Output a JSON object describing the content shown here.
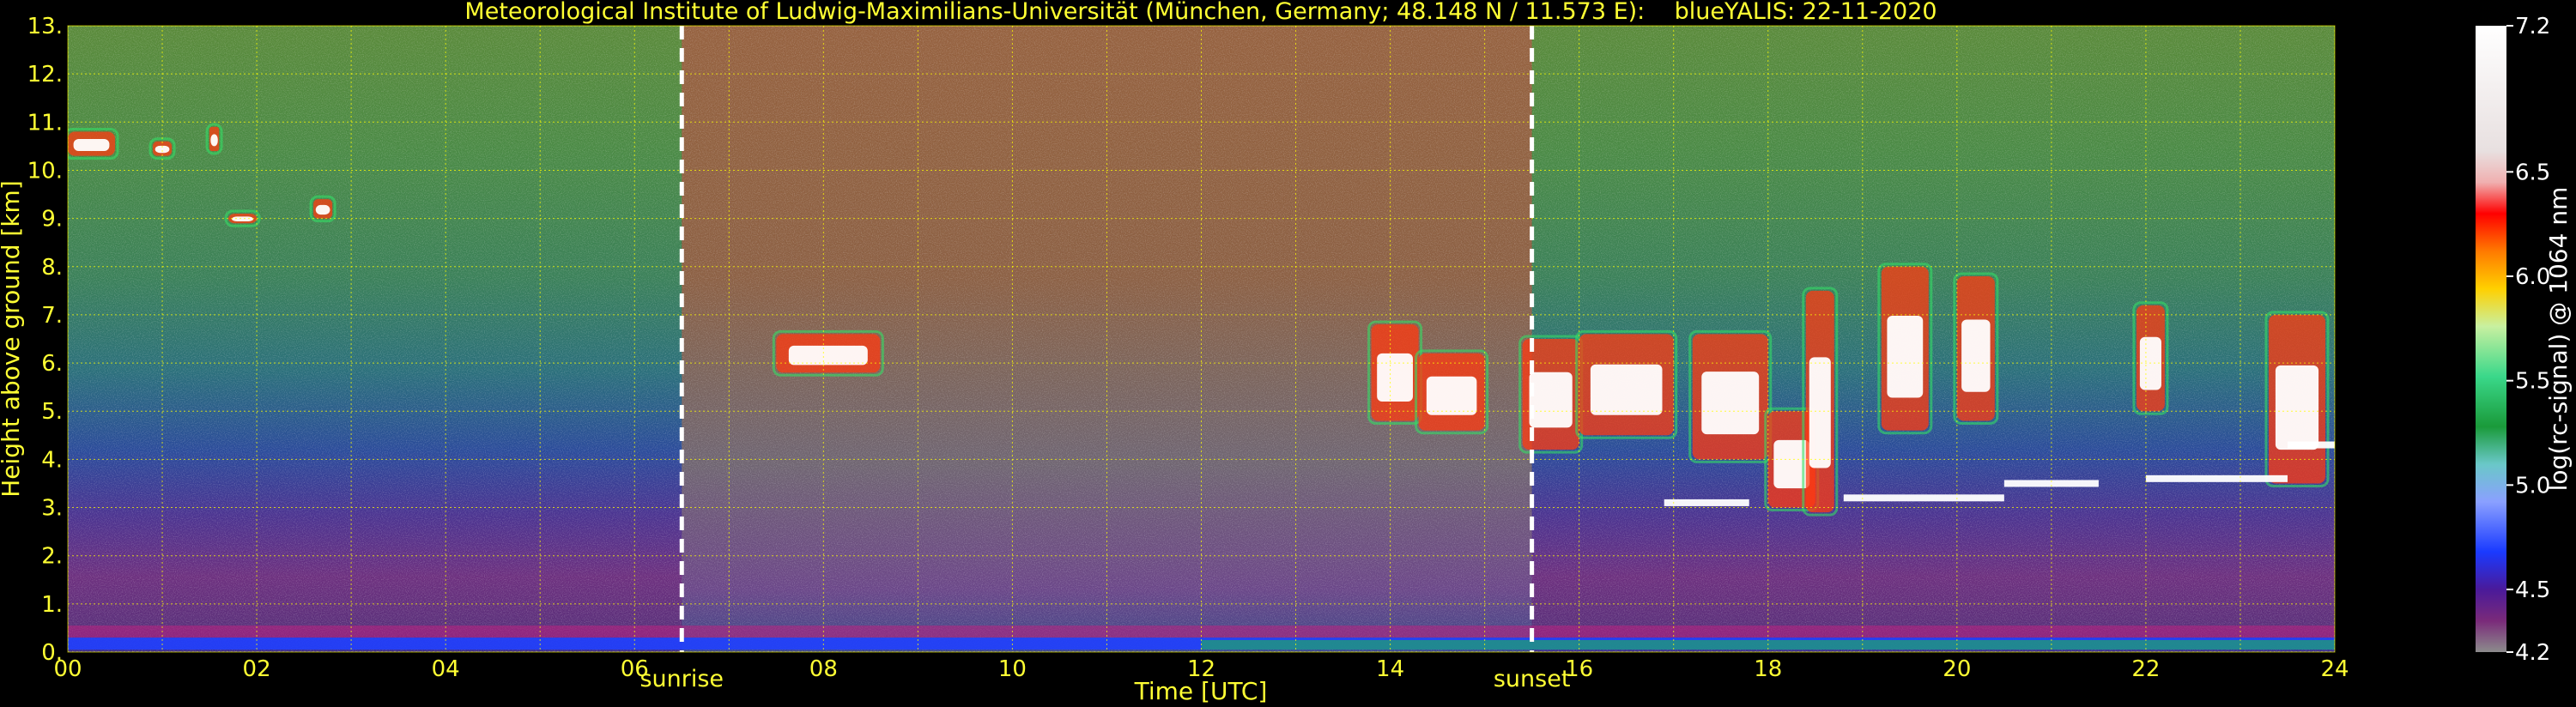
{
  "chart_data": {
    "type": "heatmap",
    "title": "Meteorological Institute of Ludwig-Maximilians-Universität (München, Germany; 48.148 N / 11.573 E):    blueYALIS: 22-11-2020",
    "xlabel": "Time [UTC]",
    "ylabel": "Height above ground [km]",
    "xlim": [
      0,
      24
    ],
    "ylim": [
      0,
      13
    ],
    "x_ticks": [
      "00",
      "02",
      "04",
      "06",
      "08",
      "10",
      "12",
      "14",
      "16",
      "18",
      "20",
      "22",
      "24"
    ],
    "y_ticks": [
      "0.",
      "1.",
      "2.",
      "3.",
      "4.",
      "5.",
      "6.",
      "7.",
      "8.",
      "9.",
      "10.",
      "11.",
      "12.",
      "13."
    ],
    "grid": true,
    "grid_color": "#ffff00",
    "colorbar": {
      "label": "log(rc-signal) @ 1064 nm",
      "range": [
        4.2,
        7.2
      ],
      "ticks": [
        "4.2",
        "4.5",
        "5.0",
        "5.5",
        "6.0",
        "6.5",
        "7.2"
      ]
    },
    "annotations": [
      {
        "text": "sunrise",
        "x": 6.5
      },
      {
        "text": "sunset",
        "x": 15.5
      }
    ],
    "cloud_layers": [
      {
        "t0": 0.0,
        "t1": 0.5,
        "h0": 10.3,
        "h1": 10.8
      },
      {
        "t0": 0.9,
        "t1": 1.1,
        "h0": 10.3,
        "h1": 10.6
      },
      {
        "t0": 1.5,
        "t1": 1.6,
        "h0": 10.4,
        "h1": 10.9
      },
      {
        "t0": 1.7,
        "t1": 2.0,
        "h0": 8.9,
        "h1": 9.1
      },
      {
        "t0": 2.6,
        "t1": 2.8,
        "h0": 9.0,
        "h1": 9.4
      },
      {
        "t0": 7.5,
        "t1": 8.6,
        "h0": 5.8,
        "h1": 6.6
      },
      {
        "t0": 13.8,
        "t1": 14.3,
        "h0": 4.8,
        "h1": 6.8
      },
      {
        "t0": 14.3,
        "t1": 15.0,
        "h0": 4.6,
        "h1": 6.2
      },
      {
        "t0": 15.4,
        "t1": 16.0,
        "h0": 4.2,
        "h1": 6.5
      },
      {
        "t0": 16.0,
        "t1": 17.0,
        "h0": 4.5,
        "h1": 6.6
      },
      {
        "t0": 17.2,
        "t1": 18.0,
        "h0": 4.0,
        "h1": 6.6
      },
      {
        "t0": 18.0,
        "t1": 18.5,
        "h0": 3.0,
        "h1": 5.0
      },
      {
        "t0": 18.4,
        "t1": 18.7,
        "h0": 2.9,
        "h1": 7.5
      },
      {
        "t0": 19.2,
        "t1": 19.7,
        "h0": 4.6,
        "h1": 8.0
      },
      {
        "t0": 20.0,
        "t1": 20.4,
        "h0": 4.8,
        "h1": 7.8
      },
      {
        "t0": 21.9,
        "t1": 22.2,
        "h0": 5.0,
        "h1": 7.2
      },
      {
        "t0": 23.3,
        "t1": 23.9,
        "h0": 3.5,
        "h1": 7.0
      }
    ],
    "thin_layers": [
      {
        "t0": 16.9,
        "t1": 17.8,
        "h": 3.1
      },
      {
        "t0": 18.8,
        "t1": 20.5,
        "h": 3.2
      },
      {
        "t0": 20.5,
        "t1": 21.5,
        "h": 3.5
      },
      {
        "t0": 22.0,
        "t1": 23.5,
        "h": 3.6
      },
      {
        "t0": 23.5,
        "t1": 24.0,
        "h": 4.3
      }
    ]
  }
}
